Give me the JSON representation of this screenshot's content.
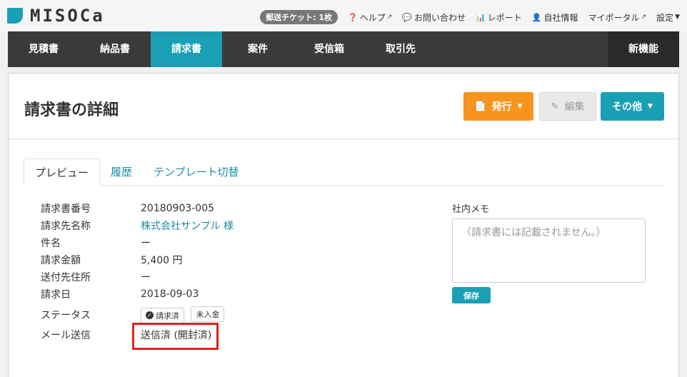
{
  "brand": {
    "name": "MISOCa",
    "accent": "#1aa0b4"
  },
  "top": {
    "ticket": "郵送チケット: 1枚",
    "links": [
      {
        "icon": "question-circle-icon",
        "label": "ヘルプ",
        "external": true
      },
      {
        "icon": "chat-bubble-icon",
        "label": "お問い合わせ",
        "external": false
      },
      {
        "icon": "bar-chart-icon",
        "label": "レポート",
        "external": false
      },
      {
        "icon": "user-icon",
        "label": "自社情報",
        "external": false
      },
      {
        "icon": "",
        "label": "マイポータル",
        "external": true
      },
      {
        "icon": "",
        "label": "設定",
        "external": false
      }
    ]
  },
  "nav": {
    "items": [
      "見積書",
      "納品書",
      "請求書",
      "案件",
      "受信箱",
      "取引先"
    ],
    "active_index": 2,
    "new_label": "新機能"
  },
  "page": {
    "title": "請求書の詳細",
    "buttons": {
      "issue": "発行",
      "edit": "編集",
      "other": "その他"
    }
  },
  "tabs": [
    "プレビュー",
    "履歴",
    "テンプレート切替"
  ],
  "details": {
    "invoice_no": {
      "label": "請求書番号",
      "value": "20180903-005"
    },
    "client": {
      "label": "請求先名称",
      "value": "株式会社サンプル 様"
    },
    "subject": {
      "label": "件名",
      "value": "ー"
    },
    "amount": {
      "label": "請求金額",
      "value": "5,400 円"
    },
    "address": {
      "label": "送付先住所",
      "value": "ー"
    },
    "date": {
      "label": "請求日",
      "value": "2018-09-03"
    },
    "status": {
      "label": "ステータス",
      "badges": [
        "請求済",
        "未入金"
      ]
    },
    "mail": {
      "label": "メール送信",
      "value": "送信済 (開封済)"
    }
  },
  "memo": {
    "label": "社内メモ",
    "placeholder": "（請求書には記載されません。）",
    "save": "保存"
  }
}
